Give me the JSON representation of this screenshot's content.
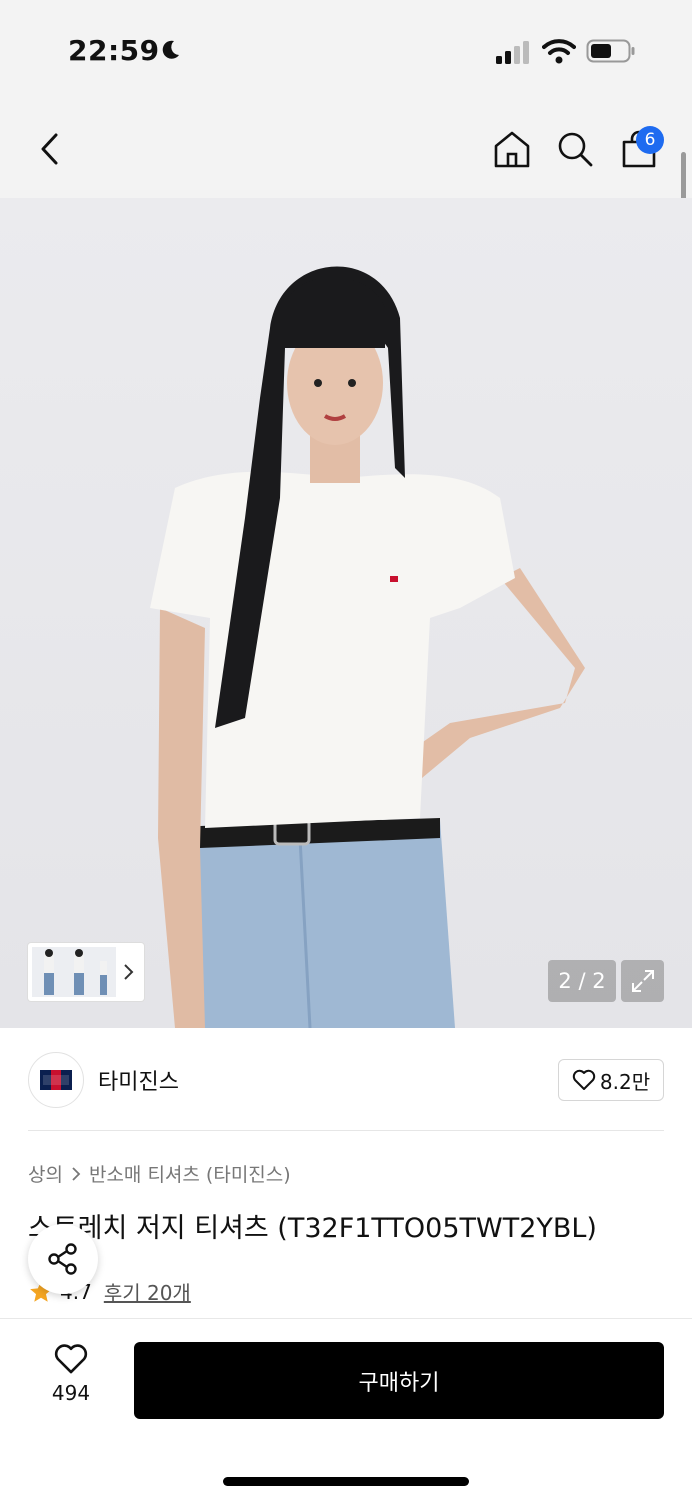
{
  "status_bar": {
    "time": "22:59"
  },
  "header": {
    "cart_count": "6"
  },
  "gallery": {
    "counter": "2 / 2"
  },
  "brand": {
    "name": "타미진스",
    "likes": "8.2만"
  },
  "breadcrumb": {
    "category": "상의",
    "subcategory": "반소매 티셔츠 (타미진스)"
  },
  "product": {
    "title": "스트레치 저지 티셔츠 (T32F1TTO05TWT2YBL)",
    "rating": "4.7",
    "reviews": "후기 20개"
  },
  "bottom": {
    "wish_count": "494",
    "buy_label": "구매하기"
  },
  "colors": {
    "accent": "#1e6bf0",
    "star": "#f5a623",
    "buy_bg": "#000000"
  }
}
